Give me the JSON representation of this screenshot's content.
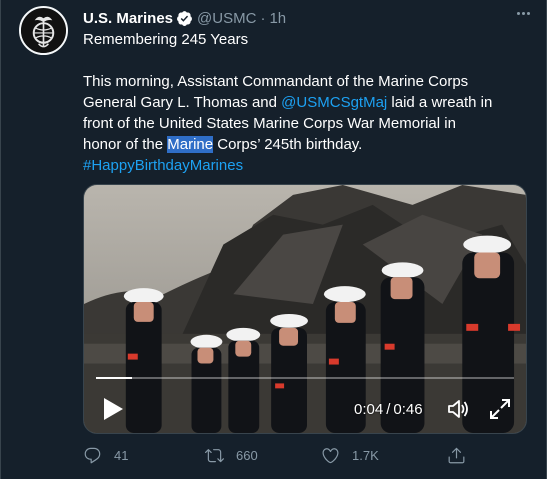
{
  "tweet": {
    "author_name": "U.S. Marines",
    "handle": "@USMC",
    "separator": "·",
    "time": "1h",
    "title": "Remembering 245 Years",
    "body": {
      "line1": "This morning, Assistant Commandant of the Marine Corps",
      "line2_pre": "General Gary L. Thomas and ",
      "mention": "@USMCSgtMaj",
      "line2_post": " laid a wreath in",
      "line3": "front of the United States Marine Corps War Memorial in",
      "line4_pre": "honor of the ",
      "line4_highlight": "Marine",
      "line4_post": " Corps’ 245th birthday.",
      "hashtag": "#HappyBirthdayMarines"
    }
  },
  "video": {
    "current_time": "0:04",
    "separator": "/",
    "duration": "0:46",
    "progress_fraction": 0.087
  },
  "actions": {
    "reply_count": "41",
    "retweet_count": "660",
    "like_count": "1.7K"
  },
  "colors": {
    "background": "#15202b",
    "accent": "#1da1f2",
    "muted": "#8899a6",
    "highlight": "#2f6ec7"
  },
  "icons": {
    "avatar": "usmc-eagle-globe-anchor",
    "verified": "verified-badge-icon",
    "more": "more-dots-icon",
    "play": "play-icon",
    "volume": "volume-icon",
    "fullscreen": "fullscreen-icon",
    "reply": "reply-icon",
    "retweet": "retweet-icon",
    "like": "like-icon",
    "share": "share-icon"
  }
}
